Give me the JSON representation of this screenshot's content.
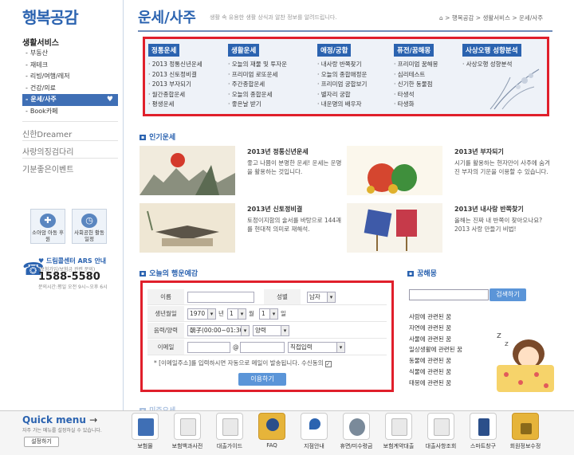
{
  "sidebar": {
    "brand": "행복공감",
    "title": "생활서비스",
    "items": [
      {
        "label": "부동산"
      },
      {
        "label": "재테크"
      },
      {
        "label": "리빙/여행/레저"
      },
      {
        "label": "건강/의료"
      },
      {
        "label": "운세/사주"
      },
      {
        "label": "Book카페"
      }
    ],
    "active_heart": "♥",
    "sections": [
      "신한Dreamer",
      "사랑의징검다리",
      "기분좋은이벤트"
    ],
    "icon_boxes": [
      {
        "label": "소아암 아동 후원"
      },
      {
        "label": "사회공헌 활동 일정"
      }
    ],
    "call": {
      "title": "♥ 드림콜센터 ARS 안내",
      "sub": "(보험가입/보험금 관련 문의)",
      "number": "1588-5580",
      "hours": "문의시간:평일 오전 9시~오후 6시"
    }
  },
  "header": {
    "title": "운세/사주",
    "desc": "생활 속 유용한 생활 상식과 알찬 정보를 알려드립니다.",
    "breadcrumb": "⌂ > 행복공감 > 생활서비스 > 운세/사주"
  },
  "menu": {
    "columns": [
      {
        "head": "정통운세",
        "items": [
          "2013 정통신년운세",
          "2013 신토정비결",
          "2013 부자되기",
          "월간종합운세",
          "평생운세"
        ]
      },
      {
        "head": "생활운세",
        "items": [
          "오늘의 재물 및 투자운",
          "프리미엄 로또운세",
          "주간종합운세",
          "오늘의 종합운세",
          "좋은날 받기"
        ]
      },
      {
        "head": "애정/궁합",
        "items": [
          "내사랑 반쪽찾기",
          "오늘의 종합애정운",
          "프리미엄 궁합보기",
          "별자리 궁합",
          "내운명의 배우자"
        ]
      },
      {
        "head": "퓨전/꿈해몽",
        "items": [
          "프리미엄 꿈해몽",
          "심리테스트",
          "신기한 동물점",
          "타생석",
          "타생화"
        ]
      },
      {
        "head": "사상오행 성향분석",
        "items": [
          "사상오행 성향분석"
        ]
      }
    ]
  },
  "popular": {
    "title": "인기운세",
    "cards": [
      {
        "title": "2013년 정통신년운세",
        "desc": "좋고 나쁨이 분명한 운세! 운세는 운명을 활용하는 것입니다."
      },
      {
        "title": "2013년 부자되기",
        "desc": "시기를 활용하는 현자만이 사주에 숨겨진 부자의 기운을 이용할 수 있습니다."
      },
      {
        "title": "2013년 신토정비결",
        "desc": "토정이지함의 술서를 바탕으로 144괘를 현대적 의미로 재해석."
      },
      {
        "title": "2013년 내사랑 반쪽찾기",
        "desc": "올해는 진짜 내 반쪽이 찾아오나요? 2013 사랑 만들기 비법!"
      }
    ]
  },
  "fortune_form": {
    "title": "오늘의 행운예감",
    "name_label": "이름",
    "gender_label": "성별",
    "gender_value": "남자",
    "birth_label": "생년월일",
    "year": "1970",
    "year_unit": "년",
    "month": "1",
    "month_unit": "월",
    "day": "1",
    "day_unit": "일",
    "calendar_label": "음력/양력",
    "time_value": "朝子(00:00~01:30)",
    "calendar_value": "양력",
    "email_label": "이메일",
    "at": "@",
    "domain_value": "직접입력",
    "notice": "* [이메일주소]를 입력하시면 자동으로 메일이 발송됩니다. 수신동의",
    "checked_mark": "✓",
    "submit": "이용하기"
  },
  "dream": {
    "title": "꿈해몽",
    "search_button": "검색하기",
    "items": [
      "사람에 관련된 꿈",
      "자연에 관련된 꿈",
      "사물에 관련된 꿈",
      "일상생활에 관련된 꿈",
      "동물에 관련된 꿈",
      "식물에 관련된 꿈",
      "태몽에 관련된 꿈"
    ]
  },
  "quick_menu": {
    "title": "Quick",
    "title2": "menu",
    "arrow": "→",
    "desc": "자주 가는 메뉴를 설정하실 수 있습니다.",
    "settings": "설정하기",
    "items": [
      {
        "label": "보험몰"
      },
      {
        "label": "보험백과사전"
      },
      {
        "label": "대출가이드"
      },
      {
        "label": "FAQ"
      },
      {
        "label": "지점안내"
      },
      {
        "label": "휴면/미수령금"
      },
      {
        "label": "보험계약대출"
      },
      {
        "label": "대출사항조회"
      },
      {
        "label": "스마트창구"
      },
      {
        "label": "회원정보수정"
      }
    ]
  },
  "peek_text": "미주요세"
}
